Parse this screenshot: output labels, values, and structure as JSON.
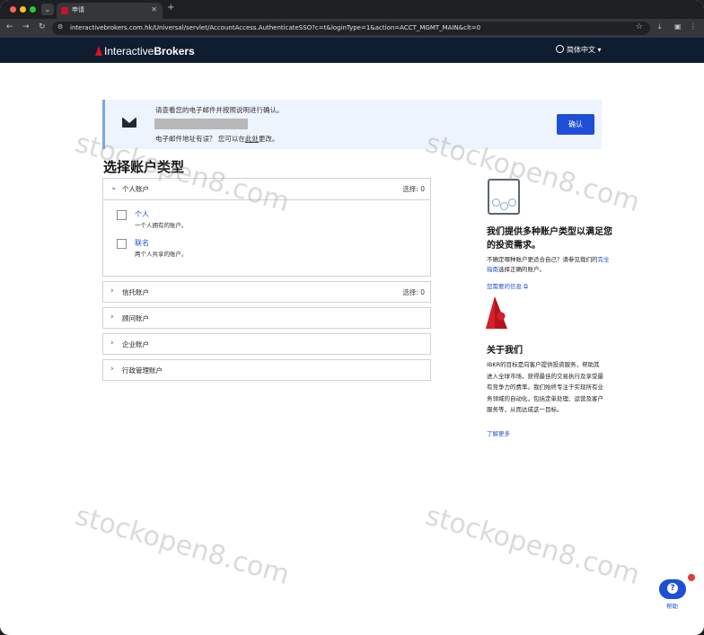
{
  "browser": {
    "tab_title": "申请",
    "url": "interactivebrokers.com.hk/Universal/servlet/AccountAccess.AuthenticateSSO?c=t&loginType=1&action=ACCT_MGMT_MAIN&clt=0"
  },
  "header": {
    "logo_light": "Interactive",
    "logo_bold": "Brokers",
    "language": "简体中文 ▾"
  },
  "banner": {
    "line1": "请查看您的电子邮件并按照说明进行确认。",
    "line2_pre": "电子邮件地址有误？ 您可以在",
    "line2_link": "此处",
    "line2_post": "更改。",
    "confirm_button": "确认"
  },
  "page_title": "选择账户类型",
  "accounts": {
    "individual": {
      "label": "个人账户",
      "count": "选择: 0",
      "options": [
        {
          "title": "个人",
          "desc": "一个人拥有的账户。"
        },
        {
          "title": "联名",
          "desc": "两个人共享的账户。"
        }
      ]
    },
    "trust": {
      "label": "信托账户",
      "count": "选择: 0"
    },
    "advisor": {
      "label": "顾问账户"
    },
    "corporate": {
      "label": "企业账户"
    },
    "admin": {
      "label": "行政管理账户"
    }
  },
  "sidebar": {
    "heading": "我们提供多种账户类型以满足您的投资需求。",
    "para_pre": "不确定哪种账户更适合自己？请参见我们的",
    "para_link": "完全指南",
    "para_post": "选择正确的账户。",
    "info_link": "您需要的信息",
    "about_heading": "关于我们",
    "about_text": "IBKR的目标是向客户提供投资服务，帮助其进入全球市场，获得最佳的交易执行及享受最有竞争力的费率。我们始终专注于实现所有业务领域的自动化，包括定单处理、运营及客户服务等，从而达成这一目标。",
    "learn_more": "了解更多"
  },
  "watermark": "stockopen8.com",
  "help": {
    "label": "帮助"
  }
}
